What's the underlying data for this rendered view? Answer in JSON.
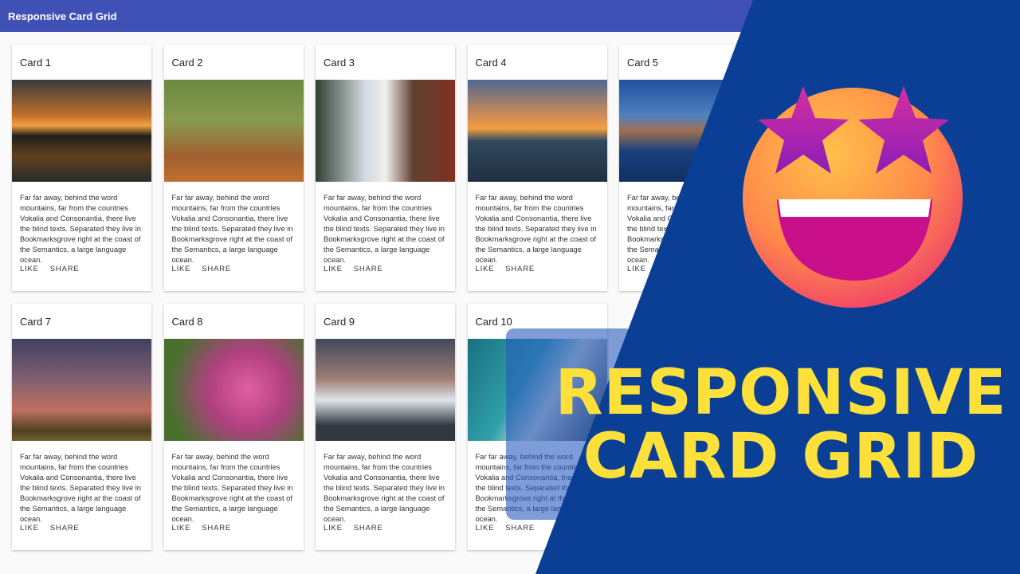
{
  "appbar": {
    "title": "Responsive Card Grid"
  },
  "card_text": "Far far away, behind the word mountains, far from the countries Vokalia and Consonantia, there live the blind texts. Separated they live in Bookmarksgrove right at the coast of the Semantics, a large language ocean.",
  "actions": {
    "like": "LIKE",
    "share": "SHARE"
  },
  "cards": [
    {
      "title": "Card 1",
      "image": "sunset-palms"
    },
    {
      "title": "Card 2",
      "image": "tree-avenue"
    },
    {
      "title": "Card 3",
      "image": "waterfall"
    },
    {
      "title": "Card 4",
      "image": "sea-sunset"
    },
    {
      "title": "Card 5",
      "image": "mountain-lake"
    },
    {
      "title": "Card 7",
      "image": "hay-bale-dusk"
    },
    {
      "title": "Card 8",
      "image": "pink-flowers"
    },
    {
      "title": "Card 9",
      "image": "snowy-mountains"
    },
    {
      "title": "Card 10",
      "image": "ocean-aerial"
    }
  ],
  "banner": {
    "line1": "RESPONSIVE",
    "line2": "CARD GRID",
    "text_color": "#fde13a",
    "bg_color": "#0b3f96"
  },
  "emoji": "star-struck-emoji"
}
